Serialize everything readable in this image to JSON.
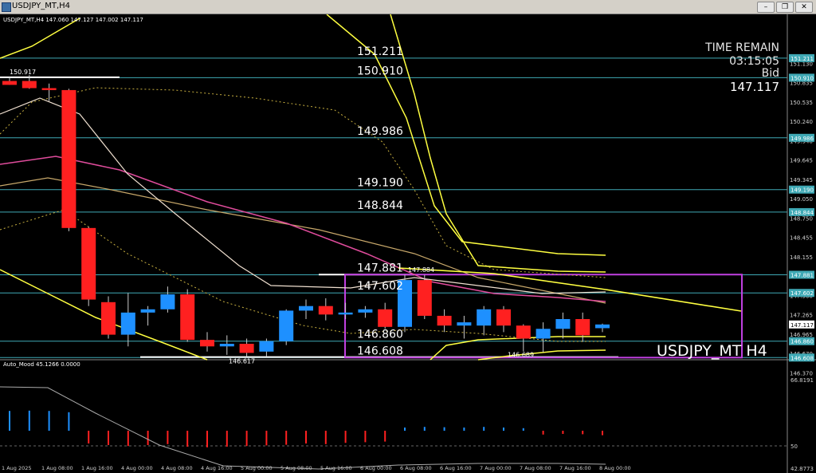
{
  "window": {
    "title": "USDJPY_MT,H4",
    "buttons": [
      "–",
      "❒",
      "✕"
    ]
  },
  "header": {
    "info": "USDJPY_MT,H4  147.060 147.127 147.002 147.117"
  },
  "colors": {
    "bull": "#1e90ff",
    "bear": "#ff2020",
    "hline": "#3fa9b5",
    "box": "#c040e0",
    "band": "#ffff40",
    "ma_pink": "#e04c9c",
    "ma_tan": "#c8a86a"
  },
  "info_panel": {
    "line1": "TIME REMAIN",
    "line2": "03:15:05",
    "line3": "Bid",
    "line4": "147.117"
  },
  "symbol_label": "USDJPY_MT H4",
  "level_labels": [
    {
      "text": "151.211",
      "price": 151.211
    },
    {
      "text": "150.910",
      "price": 150.91
    },
    {
      "text": "149.986",
      "price": 149.986
    },
    {
      "text": "149.190",
      "price": 149.19
    },
    {
      "text": "148.844",
      "price": 148.844
    },
    {
      "text": "147.881",
      "price": 147.881
    },
    {
      "text": "147.602",
      "price": 147.602
    },
    {
      "text": "146.860",
      "price": 146.86
    },
    {
      "text": "146.608",
      "price": 146.608
    }
  ],
  "small_labels": {
    "top_left": "150.917",
    "bottom_low": "146.617",
    "box_high": "147.884",
    "box_low": "146.689"
  },
  "price_axis": {
    "ticks": [
      "151.130",
      "150.835",
      "150.535",
      "150.240",
      "149.940",
      "149.645",
      "149.345",
      "149.050",
      "148.750",
      "148.455",
      "148.155",
      "147.860",
      "147.560",
      "147.265",
      "146.965",
      "146.670",
      "146.370"
    ],
    "badges": [
      "151.211",
      "150.910",
      "149.986",
      "149.190",
      "148.844",
      "147.881",
      "147.602",
      "147.117",
      "146.860",
      "146.608"
    ],
    "current": "147.117"
  },
  "time_axis": {
    "labels": [
      "1 Aug 2025",
      "1 Aug 08:00",
      "1 Aug 16:00",
      "4 Aug 00:00",
      "4 Aug 08:00",
      "4 Aug 16:00",
      "5 Aug 00:00",
      "5 Aug 08:00",
      "5 Aug 16:00",
      "6 Aug 00:00",
      "6 Aug 08:00",
      "6 Aug 16:00",
      "7 Aug 00:00",
      "7 Aug 08:00",
      "7 Aug 16:00",
      "8 Aug 00:00"
    ]
  },
  "indicator": {
    "label": "Auto_Mood 45.1266  0.0000",
    "axis": [
      "66.8191",
      "50",
      "42.8773"
    ]
  },
  "chart_data": {
    "type": "candlestick",
    "title": "USDJPY_MT,H4",
    "ylim": [
      146.2,
      151.3
    ],
    "candles": [
      {
        "t": "31 Jul",
        "o": 150.86,
        "h": 150.92,
        "l": 150.8,
        "c": 150.8
      },
      {
        "t": "1 Aug 2025",
        "o": 150.86,
        "h": 150.95,
        "l": 150.74,
        "c": 150.75
      },
      {
        "t": "1 Aug 04:00",
        "o": 150.75,
        "h": 150.82,
        "l": 150.55,
        "c": 150.72
      },
      {
        "t": "1 Aug 08:00",
        "o": 150.72,
        "h": 150.74,
        "l": 148.55,
        "c": 148.6
      },
      {
        "t": "1 Aug 12:00",
        "o": 148.6,
        "h": 148.62,
        "l": 147.4,
        "c": 147.5
      },
      {
        "t": "1 Aug 16:00",
        "o": 147.46,
        "h": 147.55,
        "l": 146.9,
        "c": 146.96
      },
      {
        "t": "1 Aug 20:00",
        "o": 146.96,
        "h": 147.6,
        "l": 146.78,
        "c": 147.3
      },
      {
        "t": "4 Aug 00:00",
        "o": 147.3,
        "h": 147.4,
        "l": 147.1,
        "c": 147.35
      },
      {
        "t": "4 Aug 04:00",
        "o": 147.35,
        "h": 147.7,
        "l": 147.3,
        "c": 147.58
      },
      {
        "t": "4 Aug 08:00",
        "o": 147.58,
        "h": 147.66,
        "l": 146.85,
        "c": 146.88
      },
      {
        "t": "4 Aug 12:00",
        "o": 146.88,
        "h": 147.0,
        "l": 146.7,
        "c": 146.78
      },
      {
        "t": "4 Aug 16:00",
        "o": 146.78,
        "h": 146.95,
        "l": 146.65,
        "c": 146.82
      },
      {
        "t": "4 Aug 20:00",
        "o": 146.82,
        "h": 146.9,
        "l": 146.62,
        "c": 146.68
      },
      {
        "t": "5 Aug 00:00",
        "o": 146.7,
        "h": 146.9,
        "l": 146.63,
        "c": 146.86
      },
      {
        "t": "5 Aug 04:00",
        "o": 146.86,
        "h": 147.35,
        "l": 146.8,
        "c": 147.33
      },
      {
        "t": "5 Aug 08:00",
        "o": 147.33,
        "h": 147.5,
        "l": 147.2,
        "c": 147.4
      },
      {
        "t": "5 Aug 12:00",
        "o": 147.4,
        "h": 147.52,
        "l": 147.18,
        "c": 147.27
      },
      {
        "t": "5 Aug 16:00",
        "o": 147.27,
        "h": 147.45,
        "l": 147.2,
        "c": 147.3
      },
      {
        "t": "5 Aug 20:00",
        "o": 147.3,
        "h": 147.4,
        "l": 147.22,
        "c": 147.35
      },
      {
        "t": "6 Aug 00:00",
        "o": 147.35,
        "h": 147.45,
        "l": 147.05,
        "c": 147.08
      },
      {
        "t": "6 Aug 04:00",
        "o": 147.08,
        "h": 147.88,
        "l": 147.0,
        "c": 147.8
      },
      {
        "t": "6 Aug 08:00",
        "o": 147.8,
        "h": 147.88,
        "l": 147.2,
        "c": 147.25
      },
      {
        "t": "6 Aug 12:00",
        "o": 147.25,
        "h": 147.35,
        "l": 147.0,
        "c": 147.1
      },
      {
        "t": "6 Aug 16:00",
        "o": 147.1,
        "h": 147.25,
        "l": 146.9,
        "c": 147.15
      },
      {
        "t": "6 Aug 20:00",
        "o": 147.1,
        "h": 147.4,
        "l": 146.95,
        "c": 147.35
      },
      {
        "t": "7 Aug 00:00",
        "o": 147.35,
        "h": 147.4,
        "l": 147.0,
        "c": 147.1
      },
      {
        "t": "7 Aug 04:00",
        "o": 147.1,
        "h": 147.12,
        "l": 146.7,
        "c": 146.9
      },
      {
        "t": "7 Aug 08:00",
        "o": 146.9,
        "h": 147.15,
        "l": 146.69,
        "c": 147.05
      },
      {
        "t": "7 Aug 12:00",
        "o": 147.05,
        "h": 147.3,
        "l": 146.9,
        "c": 147.2
      },
      {
        "t": "7 Aug 16:00",
        "o": 147.2,
        "h": 147.3,
        "l": 146.85,
        "c": 146.95
      },
      {
        "t": "7 Aug 20:00",
        "o": 147.06,
        "h": 147.13,
        "l": 147.0,
        "c": 147.117
      }
    ],
    "indicator_values": [
      62,
      63,
      62,
      58,
      -40,
      -45,
      -48,
      -45,
      -42,
      -50,
      -52,
      -50,
      -48,
      -46,
      -44,
      -40,
      -42,
      -38,
      -36,
      -34,
      10,
      12,
      11,
      10,
      12,
      10,
      8,
      -12,
      -10,
      -11,
      -14
    ]
  }
}
